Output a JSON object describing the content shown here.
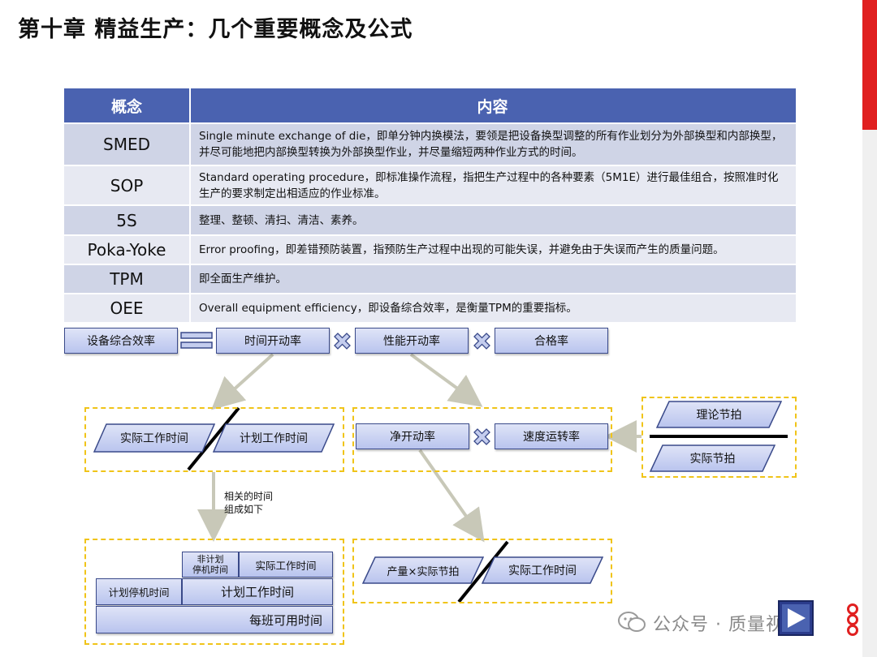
{
  "slide": {
    "title": "第十章  精益生产：几个重要概念及公式"
  },
  "table": {
    "headers": [
      "概念",
      "内容"
    ],
    "rows": [
      {
        "concept": "SMED",
        "content": "Single minute exchange of die，即单分钟内换模法，要领是把设备换型调整的所有作业划分为外部换型和内部换型，并尽可能地把内部换型转换为外部换型作业，并尽量缩短两种作业方式的时间。"
      },
      {
        "concept": "SOP",
        "content": "Standard operating procedure，即标准操作流程，指把生产过程中的各种要素（5M1E）进行最佳组合，按照准时化生产的要求制定出相适应的作业标准。"
      },
      {
        "concept": "5S",
        "content": "整理、整顿、清扫、清洁、素养。"
      },
      {
        "concept": "Poka-Yoke",
        "content": "Error proofing，即差错预防装置，指预防生产过程中出现的可能失误，并避免由于失误而产生的质量问题。"
      },
      {
        "concept": "TPM",
        "content": "即全面生产维护。"
      },
      {
        "concept": "OEE",
        "content": "Overall equipment efficiency，即设备综合效率，是衡量TPM的重要指标。"
      }
    ]
  },
  "formula": {
    "oee": "设备综合效率",
    "availability": "时间开动率",
    "performance": "性能开动率",
    "quality": "合格率"
  },
  "availability_breakdown": {
    "numerator": "实际工作时间",
    "denominator": "计划工作时间"
  },
  "performance_breakdown": {
    "net": "净开动率",
    "speed": "速度运转率"
  },
  "speed_breakdown": {
    "numerator": "理论节拍",
    "denominator": "实际节拍"
  },
  "net_breakdown": {
    "numerator": "产量×实际节拍",
    "denominator": "实际工作时间"
  },
  "note": {
    "line1": "相关的时间",
    "line2": "组成如下"
  },
  "time_composition": {
    "unplanned_stop_line1": "非计划",
    "unplanned_stop_line2": "停机时间",
    "actual_work": "实际工作时间",
    "planned_stop": "计划停机时间",
    "planned_work": "计划工作时间",
    "shift_available": "每班可用时间"
  },
  "watermark": "公众号 · 质量视界",
  "colors": {
    "header": "#4a62b0",
    "row_odd": "#cfd4e6",
    "row_even": "#e7e9f2",
    "dash": "#f0c419",
    "accent_red": "#e02020"
  }
}
